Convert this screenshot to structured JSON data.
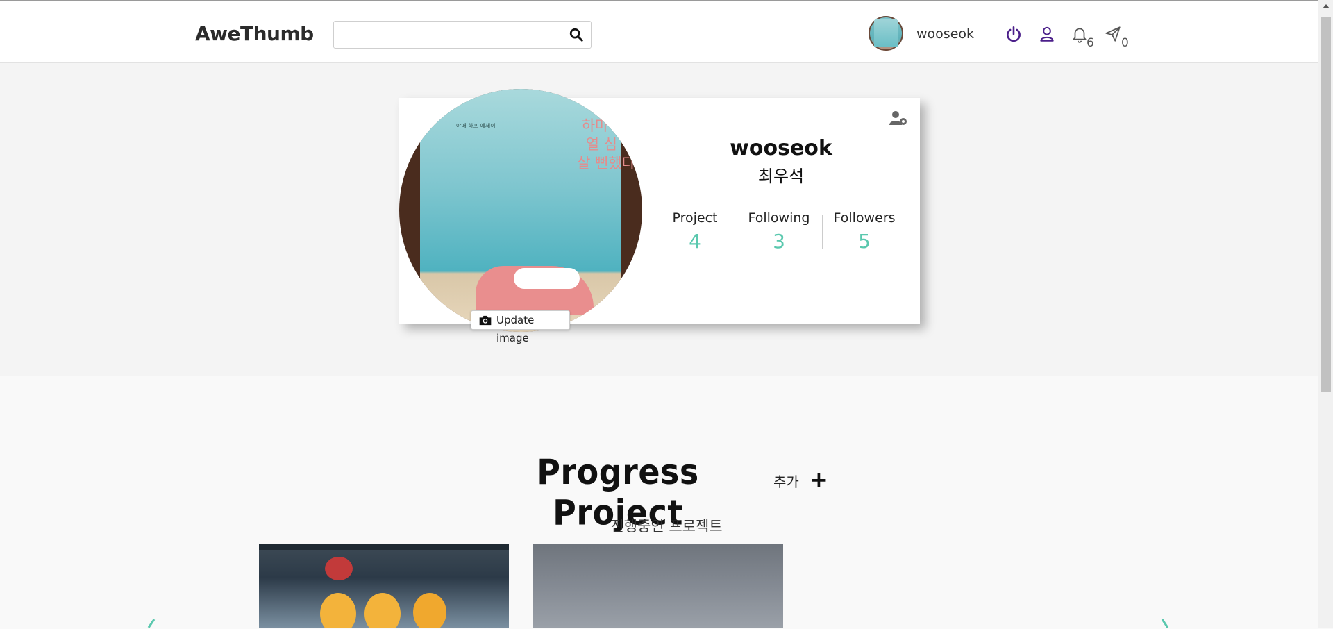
{
  "header": {
    "brand": "AweThumb",
    "search": {
      "value": "",
      "placeholder": ""
    },
    "user": {
      "name": "wooseok"
    },
    "notifications_count": "6",
    "messages_count": "0",
    "icons": {
      "search": "search-icon",
      "logout": "power-icon",
      "profile": "user-icon",
      "notifications": "bell-icon",
      "messages": "paper-plane-icon"
    },
    "colors": {
      "logout": "#4b1f8a",
      "profile": "#4b1f8a"
    }
  },
  "profile": {
    "username": "wooseok",
    "real_name": "최우석",
    "update_image_label": "Update image",
    "book_cover_text": "하마터면\n열 심 히\n살 뻔했다",
    "book_small_text": "야매 하포 에세이",
    "stats": [
      {
        "label": "Project",
        "value": "4"
      },
      {
        "label": "Following",
        "value": "3"
      },
      {
        "label": "Followers",
        "value": "5"
      }
    ],
    "stat_color": "#5ac8ae"
  },
  "progress": {
    "title": "Progress Project",
    "add_label": "추가",
    "add_symbol": "+",
    "subtitle": "진행중인 프로젝트"
  },
  "colors": {
    "accent": "#5ac8ae",
    "background": "#f9f9f9"
  }
}
